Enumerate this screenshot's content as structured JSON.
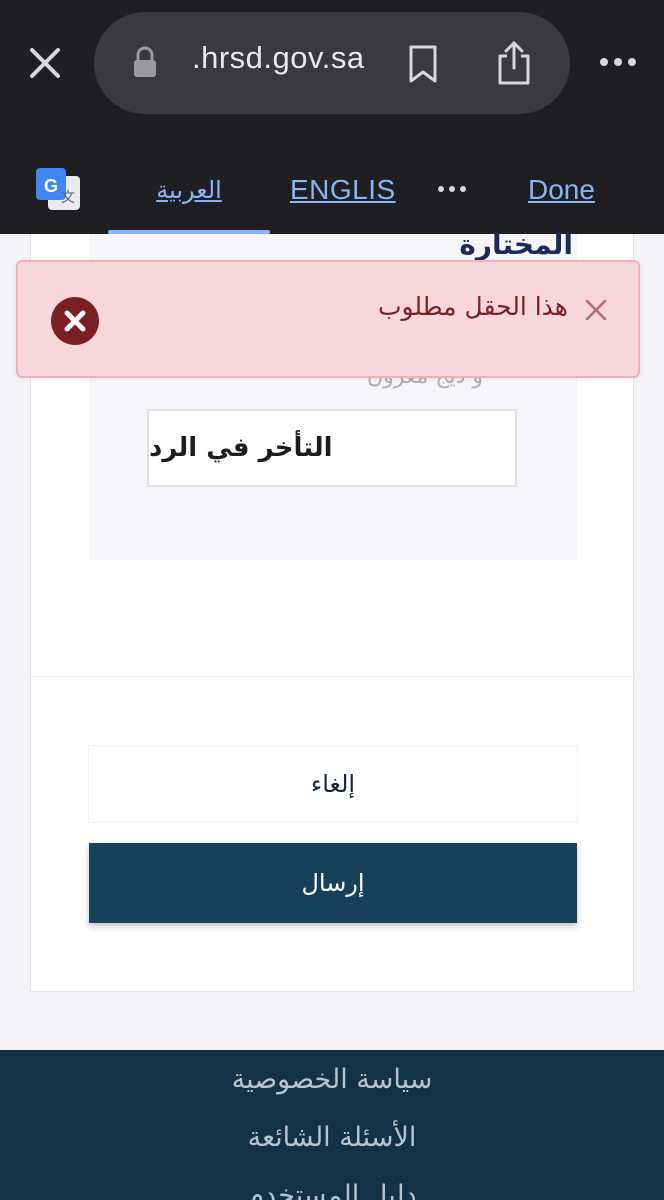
{
  "browser": {
    "url": ".hrsd.gov.sa",
    "icons": [
      "close-icon",
      "lock-icon",
      "bookmark-icon",
      "share-icon",
      "more-icon"
    ]
  },
  "translate_bar": {
    "lang_arabic": "العربية",
    "lang_english": "ENGLIS",
    "done": "Done",
    "icons": [
      "google-translate-icon",
      "more-icon"
    ]
  },
  "form": {
    "section_title": "المختارة",
    "hidden_label": "و ديج معرون",
    "selected_value": "التأخر في الرد",
    "cancel_label": "إلغاء",
    "submit_label": "إرسال"
  },
  "toast": {
    "message": "هذا الحقل مطلوب",
    "icons": [
      "error-icon",
      "close-icon"
    ],
    "color": "#f8d7da"
  },
  "footer": {
    "links": [
      "سياسة الخصوصية",
      "الأسئلة الشائعة",
      "دليل المستخدم"
    ]
  },
  "colors": {
    "primary": "#17405a",
    "footer_bg": "#123246",
    "link": "#8ab4f8"
  }
}
